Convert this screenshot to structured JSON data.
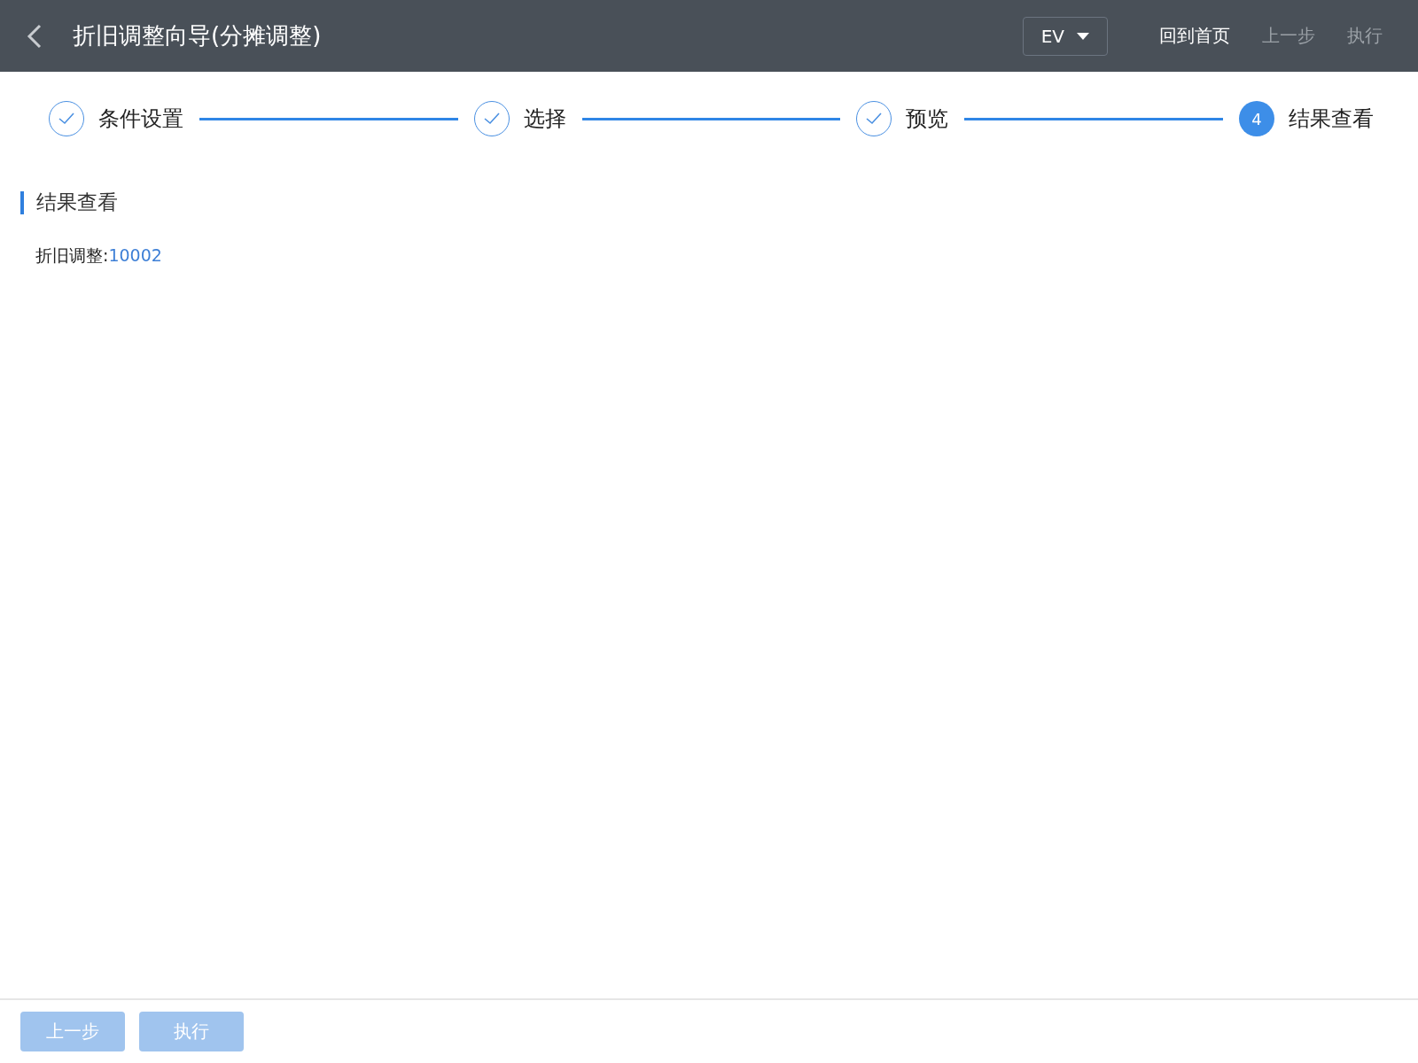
{
  "header": {
    "title": "折旧调整向导(分摊调整)",
    "dropdown": {
      "value": "EV"
    },
    "actions": [
      {
        "label": "回到首页",
        "disabled": false
      },
      {
        "label": "上一步",
        "disabled": true
      },
      {
        "label": "执行",
        "disabled": true
      }
    ]
  },
  "steps": [
    {
      "kind": "done",
      "label": "条件设置"
    },
    {
      "kind": "done",
      "label": "选择"
    },
    {
      "kind": "done",
      "label": "预览"
    },
    {
      "kind": "current",
      "number": "4",
      "label": "结果查看"
    }
  ],
  "section": {
    "title": "结果查看",
    "result": {
      "label": "折旧调整:",
      "value": "10002"
    }
  },
  "footer": {
    "buttons": [
      {
        "label": "上一步",
        "disabled": true
      },
      {
        "label": "执行",
        "disabled": true
      }
    ]
  }
}
